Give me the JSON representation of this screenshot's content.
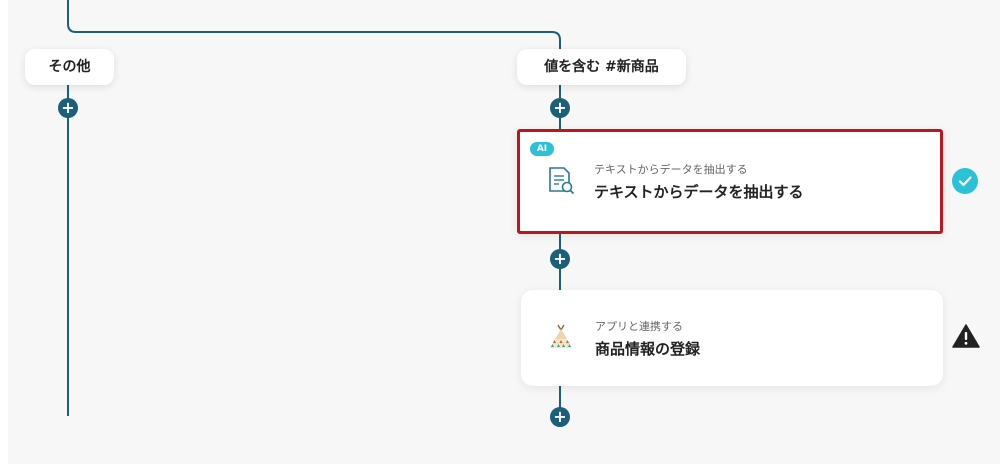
{
  "branches": {
    "left": {
      "label": "その他"
    },
    "right": {
      "label": "値を含む #新商品"
    }
  },
  "steps": [
    {
      "badge": "AI",
      "subtitle": "テキストからデータを抽出する",
      "title": "テキストからデータを抽出する",
      "icon": "document-search-icon",
      "status": "complete",
      "highlighted": true
    },
    {
      "subtitle": "アプリと連携する",
      "title": "商品情報の登録",
      "icon": "tent-app-icon",
      "status": "warning",
      "highlighted": false
    }
  ],
  "add_button": {
    "symbol": "+"
  },
  "colors": {
    "connector": "#1b5f7a",
    "accent": "#2cc1d6",
    "highlight_border": "#c0141e",
    "warning": "#222222"
  }
}
